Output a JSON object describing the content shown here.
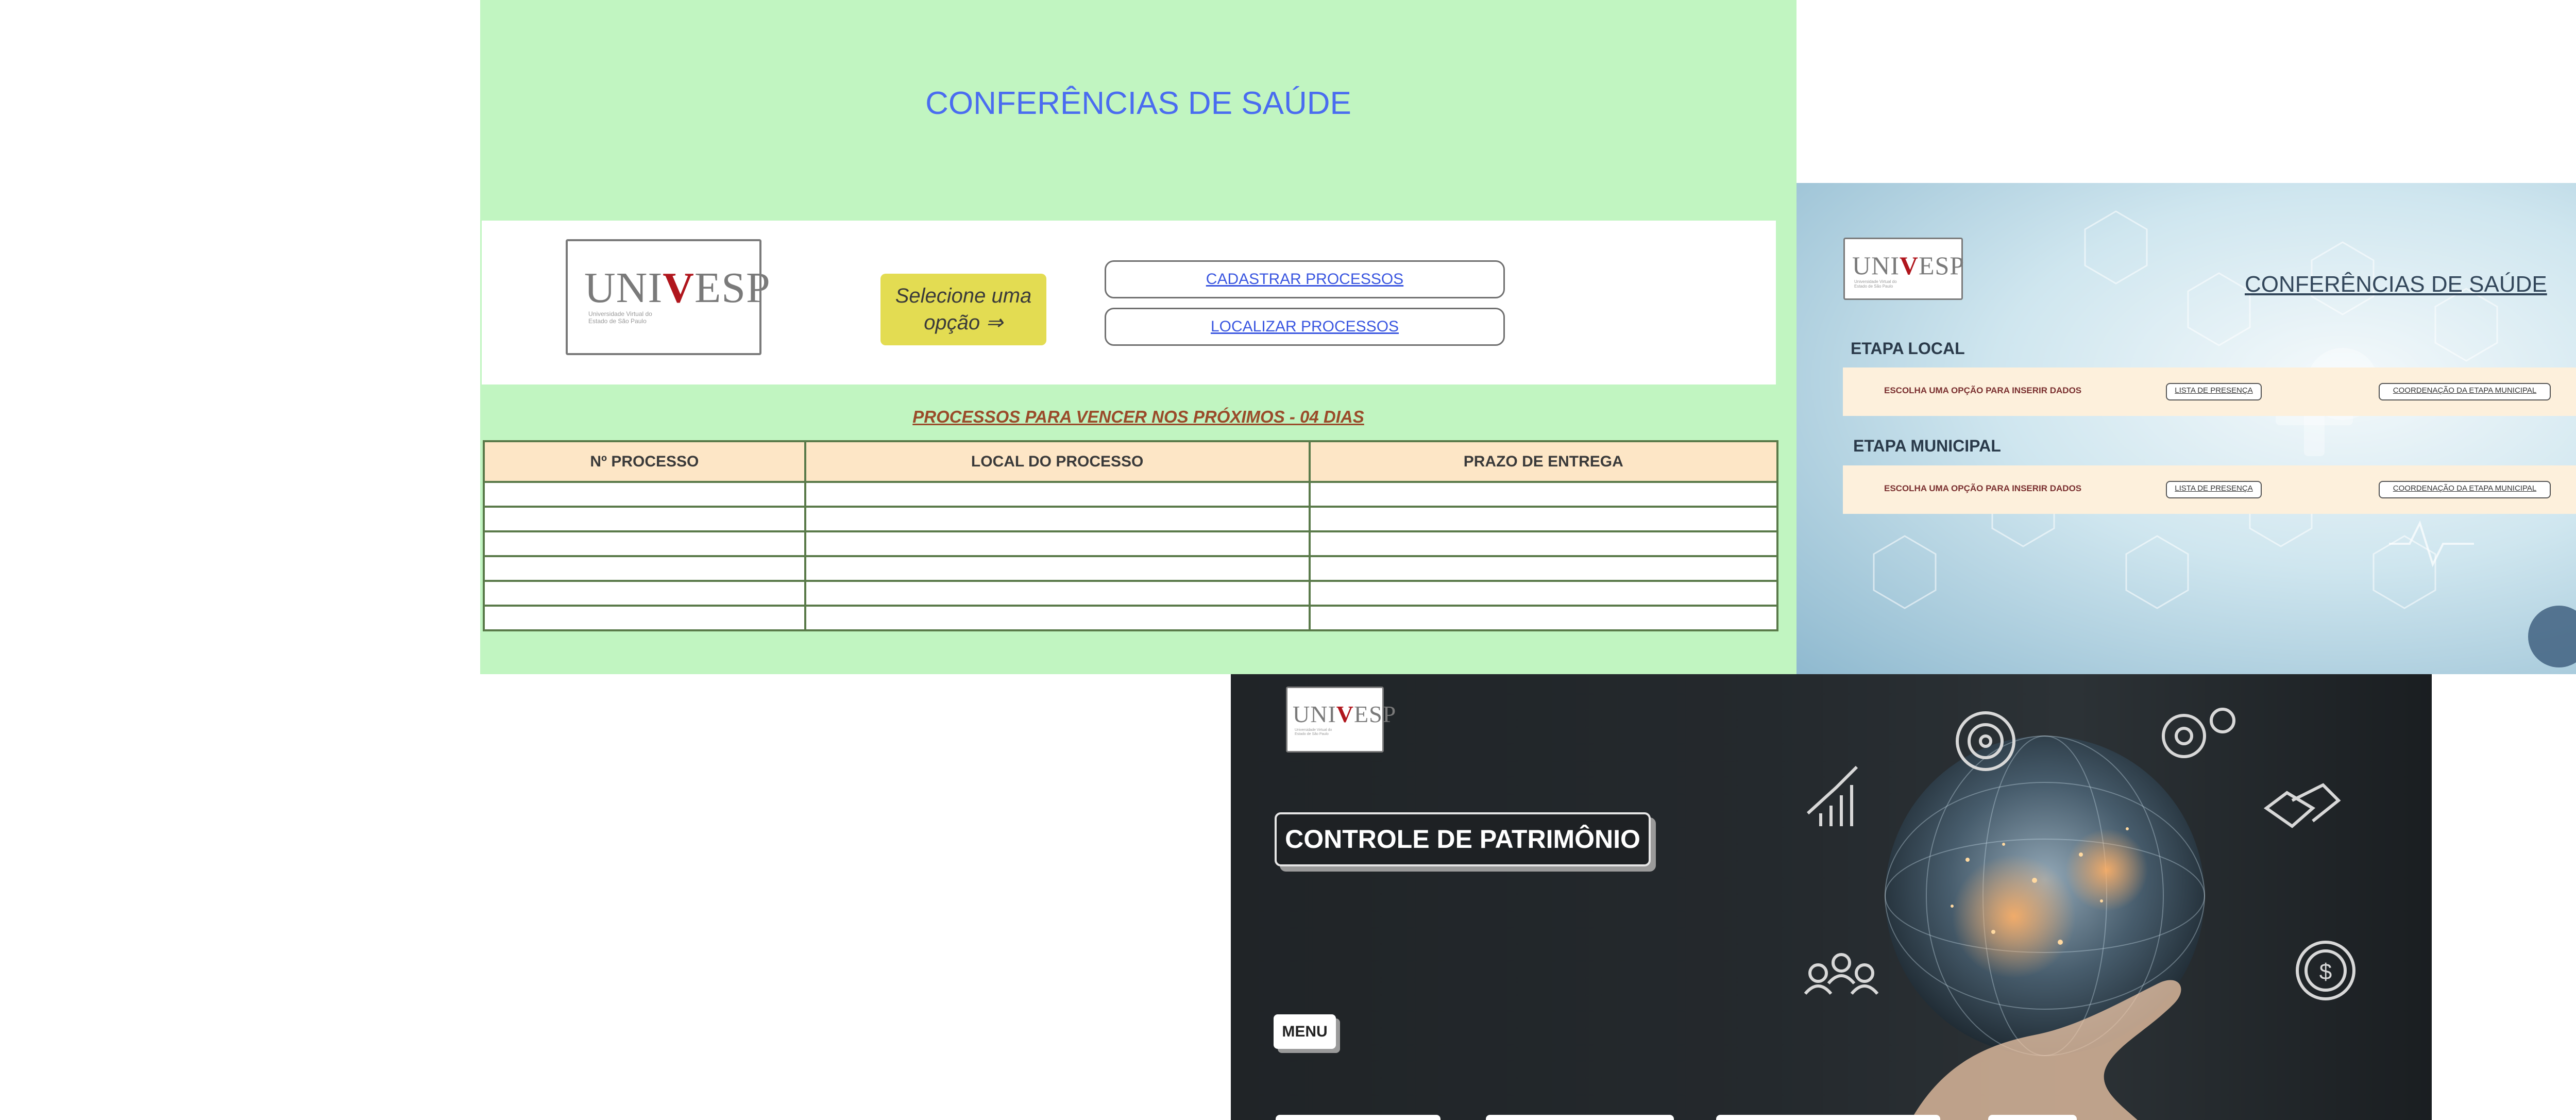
{
  "panel1": {
    "title": "CONFERÊNCIAS DE SAÚDE",
    "logo": {
      "text_left": "UNI",
      "text_v": "V",
      "text_right": "ESP",
      "subtitle": "Universidade Virtual do Estado de São Paulo"
    },
    "select_label": "Selecione uma opção ⇒",
    "buttons": [
      "CADASTRAR PROCESSOS",
      "LOCALIZAR PROCESSOS"
    ],
    "subtitle": "PROCESSOS PARA VENCER NOS PRÓXIMOS - 04 DIAS",
    "table": {
      "headers": [
        "Nº PROCESSO",
        "LOCAL DO PROCESSO",
        "PRAZO DE ENTREGA"
      ],
      "rows": [
        [
          "",
          "",
          ""
        ],
        [
          "",
          "",
          ""
        ],
        [
          "",
          "",
          ""
        ],
        [
          "",
          "",
          ""
        ],
        [
          "",
          "",
          ""
        ],
        [
          "",
          "",
          ""
        ]
      ]
    },
    "colors": {
      "background": "#c1f5c1",
      "title": "#4a6cf0",
      "header_bg": "#fde6c6",
      "select_bg": "#e3dc52"
    }
  },
  "panel2": {
    "title": "CONFERÊNCIAS DE SAÚDE",
    "logo": {
      "text_left": "UNI",
      "text_v": "V",
      "text_right": "ESP",
      "subtitle": "Universidade Virtual do Estado de São Paulo"
    },
    "stages": [
      {
        "heading": "ETAPA LOCAL",
        "note": "ESCOLHA UMA OPÇÃO PARA INSERIR DADOS",
        "buttons": [
          "LISTA DE PRESENÇA",
          "COORDENAÇÃO DA ETAPA MUNICIPAL",
          ""
        ]
      },
      {
        "heading": "ETAPA MUNICIPAL",
        "note": "ESCOLHA UMA OPÇÃO PARA INSERIR DADOS",
        "buttons": [
          "LISTA DE PRESENÇA",
          "COORDENAÇÃO DA ETAPA MUNICIPAL",
          ""
        ]
      }
    ]
  },
  "panel3": {
    "logo": {
      "text_left": "UNI",
      "text_v": "V",
      "text_right": "ESP",
      "subtitle": "Universidade Virtual do Estado de São Paulo"
    },
    "title": "CONTROLE DE PATRIMÔNIO",
    "menu_label": "MENU",
    "icons": [
      "target-icon",
      "bar-chart-icon",
      "gear-icon",
      "handshake-icon",
      "people-icon",
      "dollar-icon",
      "globe-icon",
      "hand-icon"
    ]
  }
}
